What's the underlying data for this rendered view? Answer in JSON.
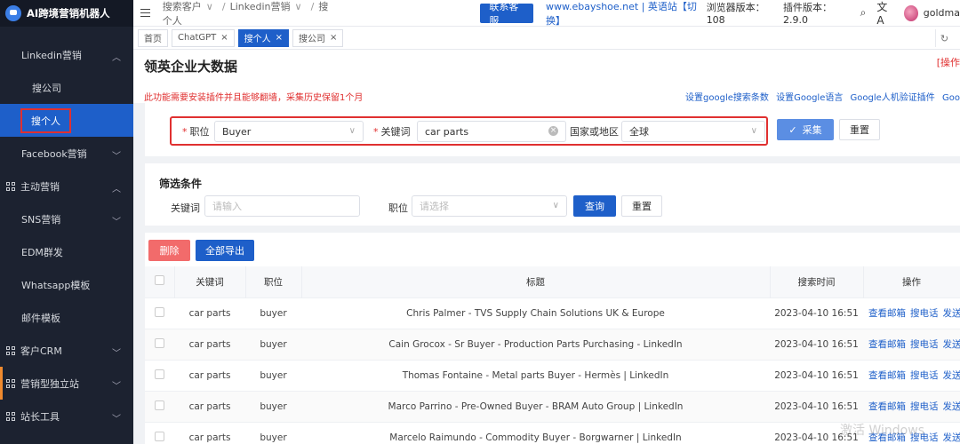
{
  "app": {
    "title": "AI跨境营销机器人"
  },
  "sidebar": {
    "items": [
      {
        "label": "Linkedin营销",
        "level": "sub-group",
        "expanded": true
      },
      {
        "label": "搜公司",
        "level": "sub"
      },
      {
        "label": "搜个人",
        "level": "sub",
        "active": true
      },
      {
        "label": "Facebook营销",
        "level": "sub-group"
      },
      {
        "label": "主动营销",
        "level": "group",
        "expanded": true
      },
      {
        "label": "SNS营销",
        "level": "sub-group"
      },
      {
        "label": "EDM群发",
        "level": "sub-group"
      },
      {
        "label": "Whatsapp模板",
        "level": "sub-group"
      },
      {
        "label": "邮件模板",
        "level": "sub-group"
      },
      {
        "label": "客户CRM",
        "level": "group"
      },
      {
        "label": "营销型独立站",
        "level": "group"
      },
      {
        "label": "站长工具",
        "level": "group"
      }
    ]
  },
  "topbar": {
    "breadcrumb": [
      "搜索客户",
      "Linkedin营销",
      "搜个人"
    ],
    "support_button": "联系客服",
    "site_link": "www.ebayshoe.net | 英语站【切换】",
    "browser_version": "浏览器版本：108",
    "plugin_version": "插件版本：2.9.0",
    "user": "goldma"
  },
  "tabs": [
    {
      "label": "首页",
      "closable": false
    },
    {
      "label": "ChatGPT",
      "closable": true
    },
    {
      "label": "搜个人",
      "closable": true,
      "active": true
    },
    {
      "label": "搜公司",
      "closable": true
    }
  ],
  "page": {
    "title": "领英企业大数据",
    "op_link": "[操作",
    "notice": "此功能需要安装插件并且能够翻墙，采集历史保留1个月",
    "right_links": [
      "设置google搜索条数",
      "设置Google语言",
      "Google人机验证插件",
      "Goo"
    ]
  },
  "search": {
    "position_label": "职位",
    "position_value": "Buyer",
    "keyword_label": "关键词",
    "keyword_value": "car parts",
    "region_label": "国家或地区",
    "region_value": "全球",
    "collect_button": "采集",
    "reset_button": "重置"
  },
  "filter": {
    "title": "筛选条件",
    "keyword_label": "关键词",
    "keyword_placeholder": "请输入",
    "position_label": "职位",
    "position_placeholder": "请选择",
    "query_button": "查询",
    "reset_button": "重置"
  },
  "table": {
    "delete_button": "删除",
    "export_button": "全部导出",
    "columns": [
      "关键词",
      "职位",
      "标题",
      "搜索时间",
      "操作"
    ],
    "rows": [
      {
        "keyword": "car parts",
        "position": "buyer",
        "title": "Chris Palmer - TVS Supply Chain Solutions UK & Europe",
        "time": "2023-04-10 16:51"
      },
      {
        "keyword": "car parts",
        "position": "buyer",
        "title": "Cain Grocox - Sr Buyer - Production Parts Purchasing - LinkedIn",
        "time": "2023-04-10 16:51"
      },
      {
        "keyword": "car parts",
        "position": "buyer",
        "title": "Thomas Fontaine - Metal parts Buyer - Hermès | LinkedIn",
        "time": "2023-04-10 16:51"
      },
      {
        "keyword": "car parts",
        "position": "buyer",
        "title": "Marco Parrino - Pre-Owned Buyer - BRAM Auto Group | LinkedIn",
        "time": "2023-04-10 16:51"
      },
      {
        "keyword": "car parts",
        "position": "buyer",
        "title": "Marcelo Raimundo - Commodity Buyer - Borgwarner | LinkedIn",
        "time": "2023-04-10 16:51"
      }
    ],
    "row_actions": [
      "查看邮箱",
      "搜电话",
      "发送"
    ]
  },
  "watermark": "激活 Windows",
  "colors": {
    "accent": "#1e5fc9",
    "danger": "#e03030",
    "sidebar_bg": "#1c2230"
  }
}
